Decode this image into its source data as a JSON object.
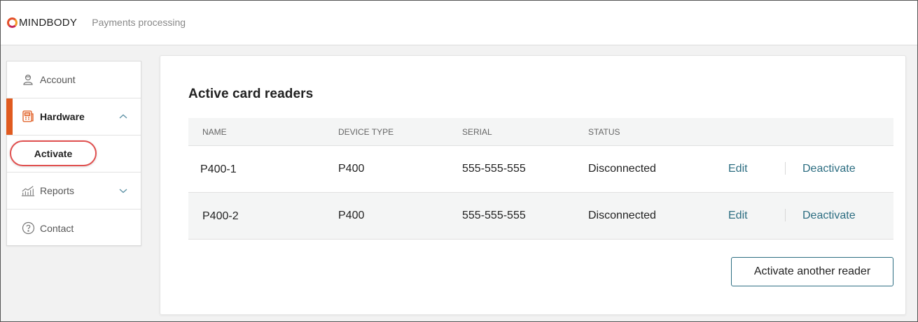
{
  "header": {
    "logo_text": "MINDBODY",
    "app_name": "Payments processing"
  },
  "sidebar": {
    "items": [
      {
        "label": "Account",
        "icon": "user-icon"
      },
      {
        "label": "Hardware",
        "icon": "card-reader-icon"
      },
      {
        "label": "Activate"
      },
      {
        "label": "Reports",
        "icon": "chart-icon"
      },
      {
        "label": "Contact",
        "icon": "help-icon"
      }
    ]
  },
  "main": {
    "title": "Active card readers",
    "columns": [
      "NAME",
      "DEVICE TYPE",
      "SERIAL",
      "STATUS"
    ],
    "rows": [
      {
        "name": "P400-1",
        "device_type": "P400",
        "serial": "555-555-555",
        "status": "Disconnected",
        "edit": "Edit",
        "deactivate": "Deactivate"
      },
      {
        "name": "P400-2",
        "device_type": "P400",
        "serial": "555-555-555",
        "status": "Disconnected",
        "edit": "Edit",
        "deactivate": "Deactivate"
      }
    ],
    "activate_button": "Activate another reader"
  },
  "colors": {
    "accent": "#e05a1f",
    "link": "#2c6d81",
    "highlight": "#e0504f"
  }
}
